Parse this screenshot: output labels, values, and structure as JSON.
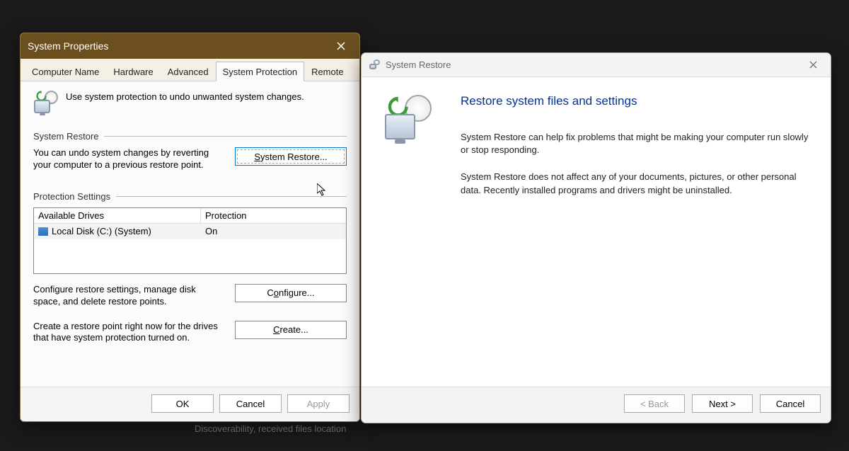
{
  "background_hint": "Discoverability, received files location",
  "sysprop": {
    "title": "System Properties",
    "tabs": [
      "Computer Name",
      "Hardware",
      "Advanced",
      "System Protection",
      "Remote"
    ],
    "active_tab_index": 3,
    "intro_text": "Use system protection to undo unwanted system changes.",
    "group_restore_label": "System Restore",
    "restore_desc": "You can undo system changes by reverting your computer to a previous restore point.",
    "restore_button": "System Restore...",
    "restore_button_underline_char": "S",
    "group_protection_label": "Protection Settings",
    "drives_table": {
      "headers": [
        "Available Drives",
        "Protection"
      ],
      "rows": [
        {
          "name": "Local Disk (C:) (System)",
          "protection": "On"
        }
      ]
    },
    "configure_desc": "Configure restore settings, manage disk space, and delete restore points.",
    "configure_button": "Configure...",
    "configure_button_underline_char": "o",
    "create_desc": "Create a restore point right now for the drives that have system protection turned on.",
    "create_button": "Create...",
    "create_button_underline_char": "C",
    "footer": {
      "ok": "OK",
      "cancel": "Cancel",
      "apply": "Apply"
    }
  },
  "restore": {
    "title": "System Restore",
    "heading": "Restore system files and settings",
    "para1": "System Restore can help fix problems that might be making your computer run slowly or stop responding.",
    "para2": "System Restore does not affect any of your documents, pictures, or other personal data. Recently installed programs and drivers might be uninstalled.",
    "footer": {
      "back": "< Back",
      "next": "Next >",
      "cancel": "Cancel"
    }
  }
}
